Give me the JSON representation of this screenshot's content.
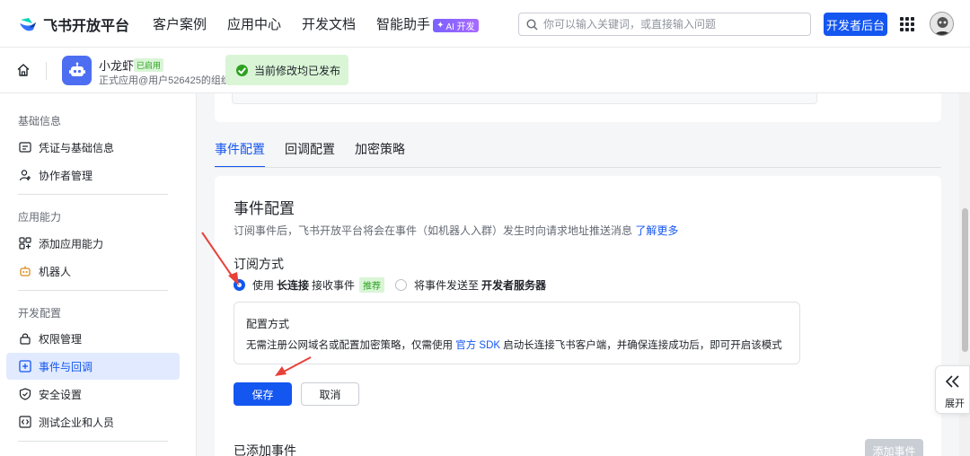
{
  "header": {
    "brand": "飞书开放平台",
    "nav": [
      "客户案例",
      "应用中心",
      "开发文档",
      "智能助手"
    ],
    "ai_badge": "AI 开发",
    "search_placeholder": "你可以输入关键词，或直接输入问题",
    "dev_console": "开发者后台"
  },
  "appbar": {
    "app_name": "小龙虾",
    "app_status": "已启用",
    "app_org": "正式应用@用户526425的组织",
    "publish_status": "当前修改均已发布"
  },
  "sidebar": {
    "sections": [
      {
        "title": "基础信息",
        "items": [
          "凭证与基础信息",
          "协作者管理"
        ]
      },
      {
        "title": "应用能力",
        "items": [
          "添加应用能力",
          "机器人"
        ]
      },
      {
        "title": "开发配置",
        "items": [
          "权限管理",
          "事件与回调",
          "安全设置",
          "测试企业和人员"
        ]
      }
    ],
    "active_item": "事件与回调"
  },
  "tabs": [
    "事件配置",
    "回调配置",
    "加密策略"
  ],
  "active_tab": "事件配置",
  "event_config": {
    "title": "事件配置",
    "description": "订阅事件后，飞书开放平台将会在事件（如机器人入群）发生时向请求地址推送消息",
    "learn_more": "了解更多",
    "subscribe_label": "订阅方式",
    "option_long_prefix": "使用",
    "option_long_bold": "长连接",
    "option_long_suffix": "接收事件",
    "recommend_badge": "推荐",
    "option_server_prefix": "将事件发送至",
    "option_server_bold": "开发者服务器",
    "selected_option": "long_connection",
    "config_title": "配置方式",
    "config_text_before": "无需注册公网域名或配置加密策略，仅需使用",
    "config_text_link": "官方 SDK",
    "config_text_after": "启动长连接飞书客户端，并确保连接成功后，即可开启该模式",
    "save": "保存",
    "cancel": "取消",
    "added_events": "已添加事件",
    "add_event": "添加事件"
  },
  "expand_label": "展开",
  "colors": {
    "accent": "#1456f0",
    "success": "#2ea121",
    "annotation_arrow": "#e8413a"
  }
}
